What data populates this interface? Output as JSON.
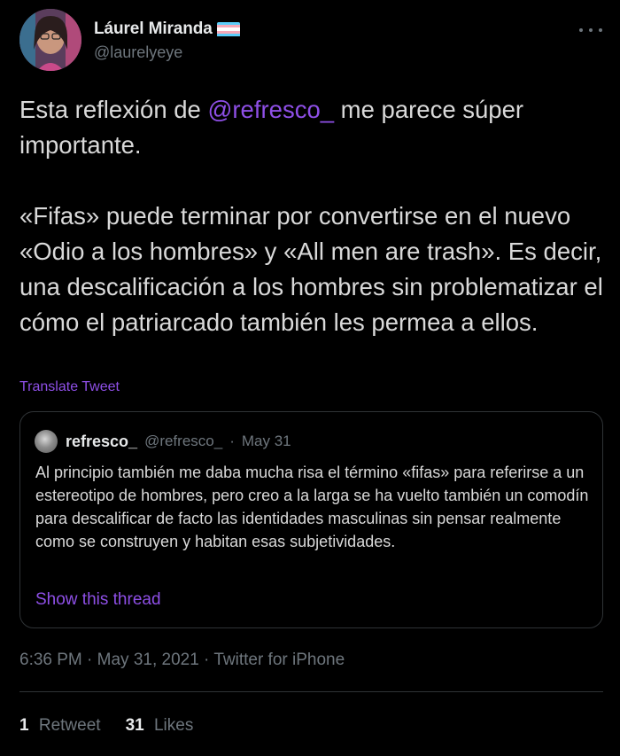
{
  "author": {
    "display_name": "Láurel Miranda",
    "handle": "@laurelyeye",
    "flag_colors": [
      "#5bcefa",
      "#f5a9b8",
      "#ffffff",
      "#f5a9b8",
      "#5bcefa"
    ]
  },
  "menu_icon": "more-horizontal-icon",
  "tweet": {
    "line1_pre": "Esta reflexión de ",
    "mention": "@refresco_",
    "line1_post": " me parece súper importante.",
    "paragraph2": "«Fifas» puede terminar por convertirse en el nuevo «Odio a los hombres» y «All men are trash». Es decir, una descalificación a los hombres sin problematizar el cómo el patriarcado también les permea a ellos."
  },
  "translate_label": "Translate Tweet",
  "quoted": {
    "name": "refresco_",
    "handle": "@refresco_",
    "separator": "·",
    "date": "May 31",
    "text": "Al principio también me daba mucha risa el término «fifas» para referirse a un estereotipo de hombres, pero creo a la larga se ha vuelto también un comodín para descalificar de facto las identidades masculinas sin pensar realmente como se construyen y habitan esas subjetividades.",
    "show_thread": "Show this thread"
  },
  "timestamp": "6:36 PM · May 31, 2021 · Twitter for iPhone",
  "stats": {
    "retweets_count": "1",
    "retweets_label": "Retweet",
    "likes_count": "31",
    "likes_label": "Likes"
  },
  "colors": {
    "accent": "#8e4fe6",
    "background": "#000000",
    "secondary_text": "#6e767d"
  }
}
